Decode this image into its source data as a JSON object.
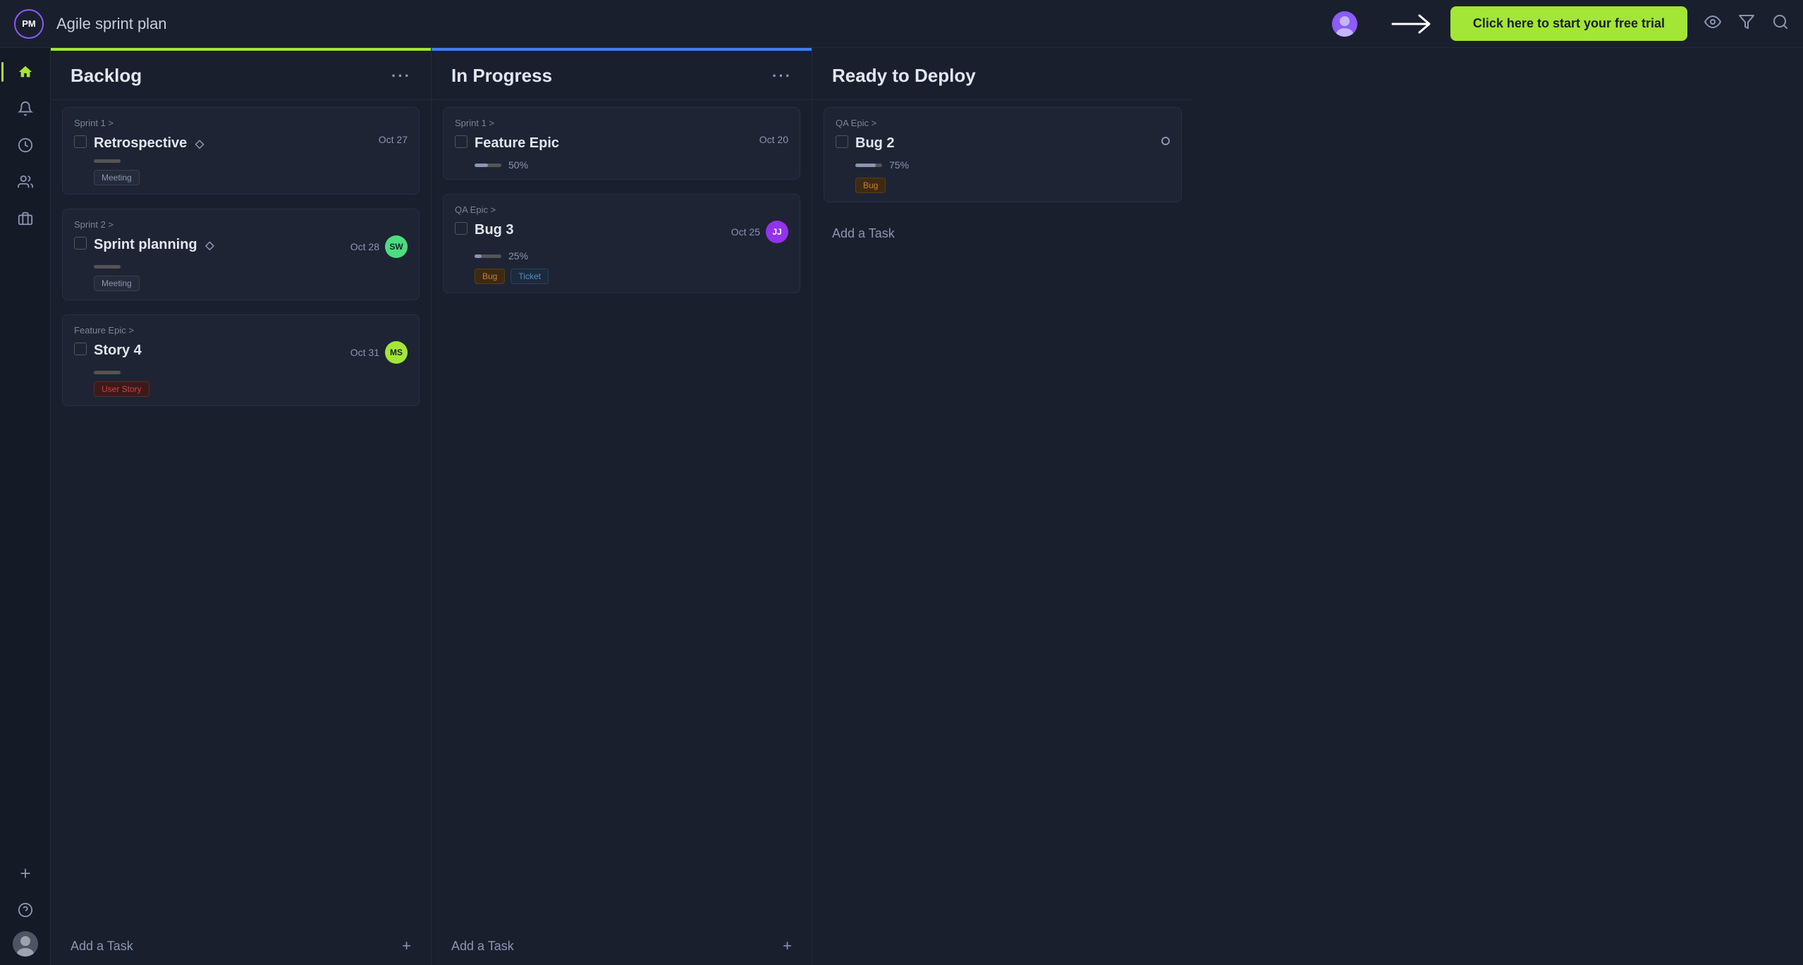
{
  "topbar": {
    "logo_text": "PM",
    "title": "Agile sprint plan",
    "cta_label": "Click here to start your free trial"
  },
  "sidebar": {
    "items": [
      {
        "name": "home",
        "icon": "⌂",
        "active": true
      },
      {
        "name": "bell",
        "icon": "🔔",
        "active": false
      },
      {
        "name": "clock",
        "icon": "⏱",
        "active": false
      },
      {
        "name": "users",
        "icon": "👥",
        "active": false
      },
      {
        "name": "briefcase",
        "icon": "💼",
        "active": false
      }
    ],
    "bottom": [
      {
        "name": "plus",
        "icon": "+"
      },
      {
        "name": "help",
        "icon": "?"
      }
    ]
  },
  "columns": [
    {
      "id": "backlog",
      "title": "Backlog",
      "accent": "green",
      "tasks": [
        {
          "id": "retrospective",
          "epic": "Sprint 1 >",
          "title": "Retrospective",
          "has_diamond": true,
          "date": "Oct 27",
          "progress_pct": 0,
          "show_progress_bar": true,
          "show_progress_label": false,
          "tags": [
            "Meeting"
          ],
          "assignee": null
        },
        {
          "id": "sprint-planning",
          "epic": "Sprint 2 >",
          "title": "Sprint planning",
          "has_diamond": true,
          "date": "Oct 28",
          "progress_pct": 0,
          "show_progress_bar": true,
          "show_progress_label": false,
          "tags": [
            "Meeting"
          ],
          "assignee": {
            "initials": "SW",
            "color": "#4ade80"
          }
        },
        {
          "id": "story-4",
          "epic": "Feature Epic >",
          "title": "Story 4",
          "has_diamond": false,
          "date": "Oct 31",
          "progress_pct": 0,
          "show_progress_bar": true,
          "show_progress_label": false,
          "tags": [
            "User Story"
          ],
          "assignee": {
            "initials": "MS",
            "color": "#a3e635"
          }
        }
      ],
      "add_task_label": "Add a Task"
    },
    {
      "id": "in-progress",
      "title": "In Progress",
      "accent": "blue",
      "tasks": [
        {
          "id": "feature-epic",
          "epic": "Sprint 1 >",
          "title": "Feature Epic",
          "has_diamond": false,
          "date": "Oct 20",
          "progress_pct": 50,
          "show_progress_bar": true,
          "show_progress_label": true,
          "progress_label": "50%",
          "tags": [],
          "assignee": null
        },
        {
          "id": "bug-3",
          "epic": "QA Epic >",
          "title": "Bug 3",
          "has_diamond": false,
          "date": "Oct 25",
          "progress_pct": 25,
          "show_progress_bar": true,
          "show_progress_label": true,
          "progress_label": "25%",
          "tags": [
            "Bug",
            "Ticket"
          ],
          "assignee": {
            "initials": "JJ",
            "color": "#9333ea"
          }
        }
      ],
      "add_task_label": "Add a Task"
    },
    {
      "id": "ready-to-deploy",
      "title": "Ready to Deploy",
      "accent": "transparent",
      "tasks": [
        {
          "id": "bug-2",
          "epic": "QA Epic >",
          "title": "Bug 2",
          "has_diamond": false,
          "date": null,
          "progress_pct": 75,
          "show_progress_bar": true,
          "show_progress_label": true,
          "progress_label": "75%",
          "tags": [
            "Bug"
          ],
          "assignee": null,
          "show_status_circle": true
        }
      ],
      "add_task_label": "Add a Task"
    }
  ]
}
